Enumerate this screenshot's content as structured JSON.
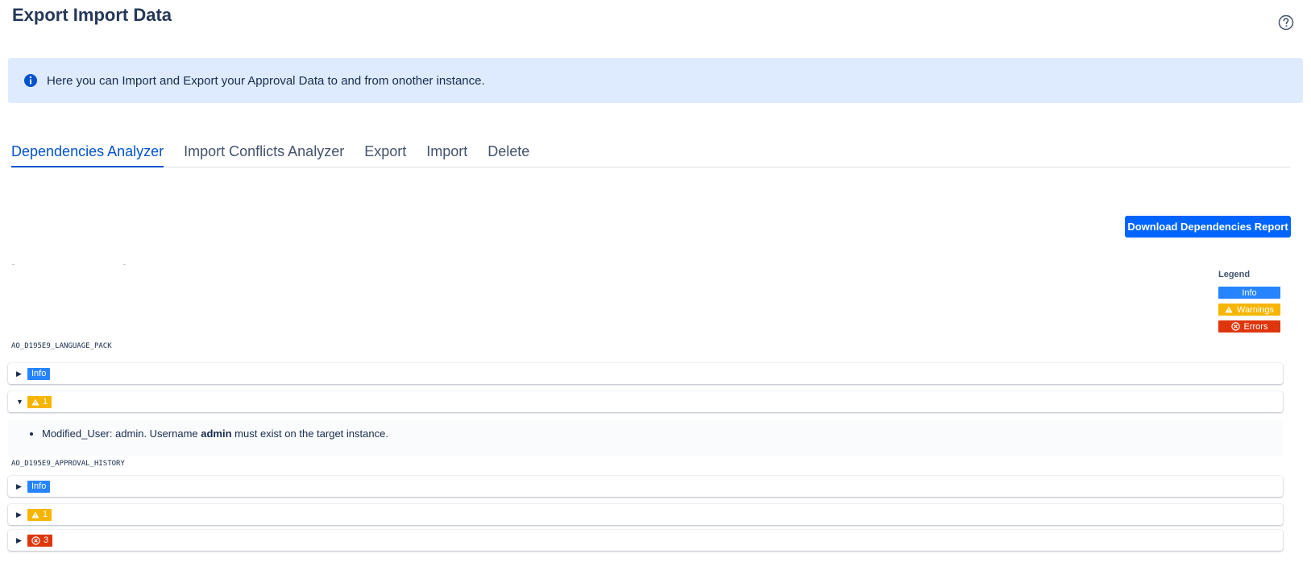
{
  "page": {
    "title": "Export Import Data",
    "help_icon": "question-circle-icon"
  },
  "banner": {
    "icon": "info-circle-icon",
    "text": "Here you can Import and Export your Approval Data to and from onother instance."
  },
  "tabs": [
    {
      "label": "Dependencies Analyzer",
      "active": true
    },
    {
      "label": "Import Conflicts Analyzer",
      "active": false
    },
    {
      "label": "Export",
      "active": false
    },
    {
      "label": "Import",
      "active": false
    },
    {
      "label": "Delete",
      "active": false
    }
  ],
  "actions": {
    "download_label": "Download Dependencies Report"
  },
  "legend": {
    "title": "Legend",
    "info": "Info",
    "warnings": "Warnings",
    "errors": "Errors"
  },
  "sections": [
    {
      "name": "AO_D195E9_LANGUAGE_PACK",
      "rows": [
        {
          "type": "info",
          "label": "Info",
          "expanded": false
        },
        {
          "type": "warning",
          "label": "1",
          "expanded": true,
          "details": [
            {
              "prefix": "Modified_User: admin. Username ",
              "bold": "admin",
              "suffix": " must exist on the target instance."
            }
          ]
        }
      ]
    },
    {
      "name": "AO_D195E9_APPROVAL_HISTORY",
      "rows": [
        {
          "type": "info",
          "label": "Info",
          "expanded": false
        },
        {
          "type": "warning",
          "label": "1",
          "expanded": false
        },
        {
          "type": "error",
          "label": "3",
          "expanded": false
        }
      ]
    }
  ],
  "colors": {
    "primary": "#0065ff",
    "info": "#2684ff",
    "warning": "#f7b500",
    "error": "#de350b",
    "banner_bg": "#deebff"
  }
}
